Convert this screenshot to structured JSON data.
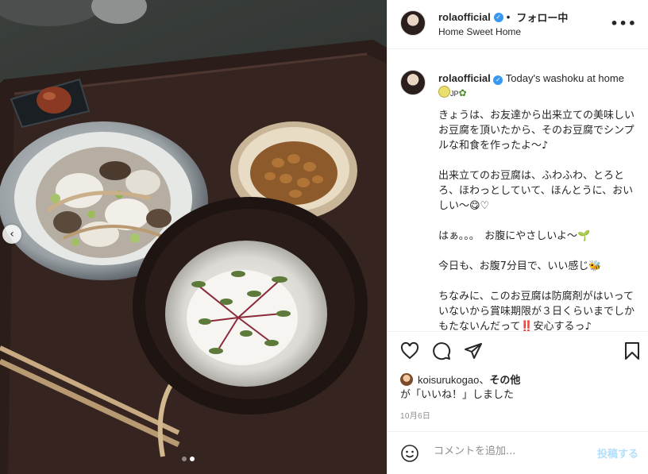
{
  "header": {
    "username": "rolaofficial",
    "separator": "•",
    "follow_status": "フォロー中",
    "subtitle": "Home Sweet Home",
    "more_icon": "more-horizontal-icon"
  },
  "caption": {
    "username": "rolaofficial",
    "headline": "Today's washoku at home",
    "flag_label": "JP",
    "paragraphs": [
      "きょうは、お友達から出来立ての美味しいお豆腐を頂いたから、そのお豆腐でシンプルな和食を作ったよ〜♪",
      "出来立てのお豆腐は、ふわふわ、とろとろ、ほわっとしていて、ほんとうに、おいしい〜😋♡",
      "はぁ。。。　お腹にやさしいよ〜🌱",
      "今日も、お腹7分目で、いい感じ🐝",
      "ちなみに、このお豆腐は防腐剤がはいっていないから賞味期限が３日くらいまでしかもたないんだって‼️安心するっ♪"
    ]
  },
  "actions": {
    "like_icon": "heart-icon",
    "comment_icon": "comment-icon",
    "share_icon": "paper-plane-icon",
    "save_icon": "bookmark-icon"
  },
  "likes": {
    "liker": "koisurukogao",
    "connector": "、",
    "others": "その他",
    "suffix": "が「いいね！」しました"
  },
  "date": "10月6日",
  "comment": {
    "placeholder": "コメントを追加...",
    "post_label": "投稿する"
  },
  "carousel": {
    "total": 2,
    "current": 2,
    "prev_icon": "chevron-left-icon"
  },
  "colors": {
    "verified": "#3897f0",
    "post_disabled": "#b2dffc",
    "muted": "#8e8e8e"
  }
}
